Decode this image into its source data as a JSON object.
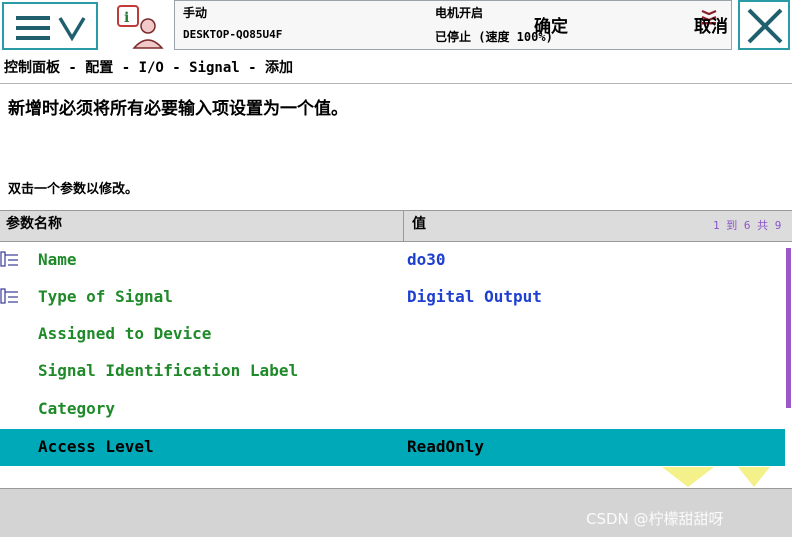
{
  "header": {
    "mode": "手动",
    "hostname": "DESKTOP-QO85U4F",
    "motor_state": "电机开启",
    "run_state": "已停止 (速度 100%)"
  },
  "breadcrumb": "控制面板 - 配置 - I/O - Signal - 添加",
  "message_main": "新增时必须将所有必要输入项设置为一个值。",
  "message_sub": "双击一个参数以修改。",
  "table": {
    "col_name": "参数名称",
    "col_value": "值",
    "page_info": "1 到 6 共 9",
    "rows": [
      {
        "name": "Name",
        "value": "do30"
      },
      {
        "name": "Type of Signal",
        "value": "Digital Output"
      },
      {
        "name": "Assigned to Device",
        "value": ""
      },
      {
        "name": "Signal Identification Label",
        "value": ""
      },
      {
        "name": "Category",
        "value": ""
      },
      {
        "name": "Access Level",
        "value": "ReadOnly"
      }
    ]
  },
  "footer": {
    "ok_label": "确定",
    "cancel_label": "取消"
  },
  "watermark": "CSDN @柠檬甜甜呀",
  "colors": {
    "accent": "#00a9b7",
    "param_name": "#1f8a2a",
    "param_value": "#1f3fd0",
    "scrollbar": "#9a58c8"
  }
}
